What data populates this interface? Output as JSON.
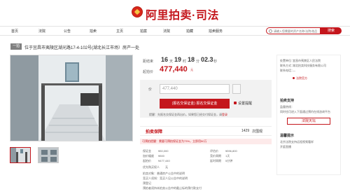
{
  "brand": {
    "title": "阿里拍卖·司法"
  },
  "nav": {
    "items": [
      "首页",
      "法院",
      "公告",
      "拍卖",
      "主页",
      "拍案",
      "法院",
      "拍藏",
      "拍卖服务"
    ]
  },
  "search": {
    "placeholder": "请输入您需要的资产名称/法院/拍品",
    "button": "搜索"
  },
  "lot": {
    "tag": "一拍",
    "title": "位于宜昌市夷陵区湖光路17-4-102号(湖北长江市场）房产一处"
  },
  "countdown": {
    "label": "距结束",
    "days": "16",
    "days_unit": "天",
    "hours": "19",
    "hours_unit": "时",
    "minutes": "18",
    "minutes_unit": "分",
    "seconds": "02.3",
    "seconds_unit": "秒"
  },
  "price": {
    "label": "起拍价",
    "value": "477,440",
    "unit": "元"
  },
  "bid": {
    "label": "价",
    "input_value": "477,440",
    "signup_button": "(报名交保证金) 报名交保证金",
    "remind_button": "设置提醒",
    "notice_prefix": "提醒：先报名交保证金再出价。如果您已经交付保证金，请",
    "notice_link": "登录"
  },
  "stats": {
    "guarantee": "拍卖保障",
    "views": "1429",
    "views_unit": "次围观"
  },
  "warn": {
    "text": "可预拍提醒：需要可预拍保证金为73%，立即用50万"
  },
  "info": {
    "deposit_label": "保证金",
    "deposit_value": "¥50,000",
    "increment_label": "加价幅度",
    "increment_value": "¥500",
    "assess_label": "评估价",
    "assess_value": "¥596,800",
    "cycle_label": "竞价周期",
    "cycle_value": "1天",
    "start_label": "起拍价",
    "start_value": "¥477,440",
    "delay_label": "延时周期",
    "delay_value": "5分钟",
    "priority_label": "优先购买权人",
    "priority_value": "无",
    "note1": "拍卖对象：普通房产公告中的说明",
    "note2": "竞买人须知：竞买人见公告中的说明",
    "note3": "预登记",
    "note4": "预拍者须持本拍卖公告中的截止标的预付款支付"
  },
  "right": {
    "court_label": "处置单位：",
    "court_name": "宜昌市夷陵区人民法院",
    "contact_label": "联系方式：",
    "contact_value": "湖北拍卖科技服务有限公司",
    "service_label": "联系电话：",
    "service_value": "—",
    "official_label": "法院官方",
    "support_title": "拍卖支持",
    "support_line1": "监督热线：",
    "support_line2": "同时也可进入下面通过预约在线咨询平台",
    "support_btn": "法院天坛",
    "bottom_line1": "温馨提示",
    "bottom_line2": "北京法院支持远程视频看样",
    "bottom_line3": "开庭直播"
  },
  "colors": {
    "brand_red": "#c4161c",
    "gray_tag": "#808080",
    "panel_gray": "#f2f2f2"
  }
}
